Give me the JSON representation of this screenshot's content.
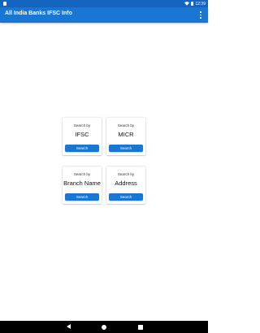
{
  "status_bar": {
    "time": "12:39",
    "icons": [
      "notification-icon",
      "wifi-icon",
      "battery-icon"
    ]
  },
  "app_bar": {
    "title": "All India Banks IFSC Info",
    "menu_icon": "overflow-menu-icon"
  },
  "colors": {
    "status_bar": "#1565c0",
    "app_bar": "#1976d2",
    "button": "#1976d2"
  },
  "cards": [
    {
      "caption": "Search by",
      "field": "IFSC",
      "button": "Search"
    },
    {
      "caption": "Search by",
      "field": "MICR",
      "button": "Search"
    },
    {
      "caption": "Search by",
      "field": "Branch Name",
      "button": "Search"
    },
    {
      "caption": "Search by",
      "field": "Address",
      "button": "Search"
    }
  ],
  "nav_bar": {
    "icons": [
      "back-icon",
      "home-icon",
      "recents-icon"
    ]
  }
}
